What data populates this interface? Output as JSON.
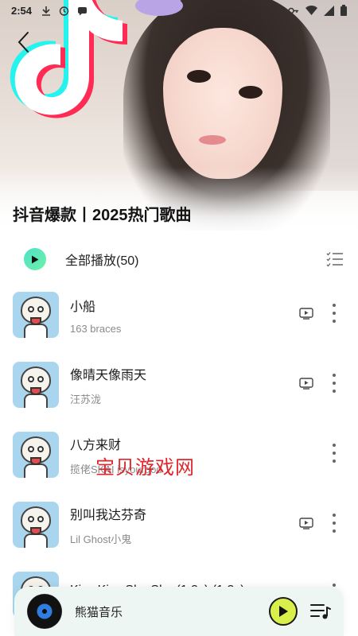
{
  "status_bar": {
    "time": "2:54",
    "icons": [
      "download-icon",
      "alarm-icon",
      "chat-icon",
      "vpn-key-icon",
      "wifi-icon",
      "signal-icon",
      "battery-icon"
    ]
  },
  "header": {
    "back_icon": "back-arrow-icon",
    "playlist_title": "抖音爆款丨2025热门歌曲"
  },
  "play_all": {
    "label": "全部播放(50)",
    "play_icon": "play-icon",
    "list_icon": "multi-select-list-icon"
  },
  "songs": [
    {
      "title": "小船",
      "artist": "163 braces",
      "has_mv": true
    },
    {
      "title": "像晴天像雨天",
      "artist": "汪苏泷",
      "has_mv": true
    },
    {
      "title": "八方来财",
      "artist": "揽佬SKAI isyourgod",
      "has_mv": false
    },
    {
      "title": "别叫我达芬奇",
      "artist": "Lil Ghost小鬼",
      "has_mv": true
    },
    {
      "title": "Kiss Kiss Shy Shy (1.2x) (1.2x)",
      "artist": "",
      "has_mv": false
    }
  ],
  "watermark": "宝贝游戏网",
  "player": {
    "app_name": "熊猫音乐",
    "disc_icon": "vinyl-disc-icon",
    "play_icon": "play-icon",
    "queue_icon": "playlist-queue-icon"
  },
  "colors": {
    "accent_teal": "#4fe0c8",
    "play_button": "#d9f04a",
    "watermark_red": "#e0262b",
    "player_bg": "#eef6f4"
  }
}
